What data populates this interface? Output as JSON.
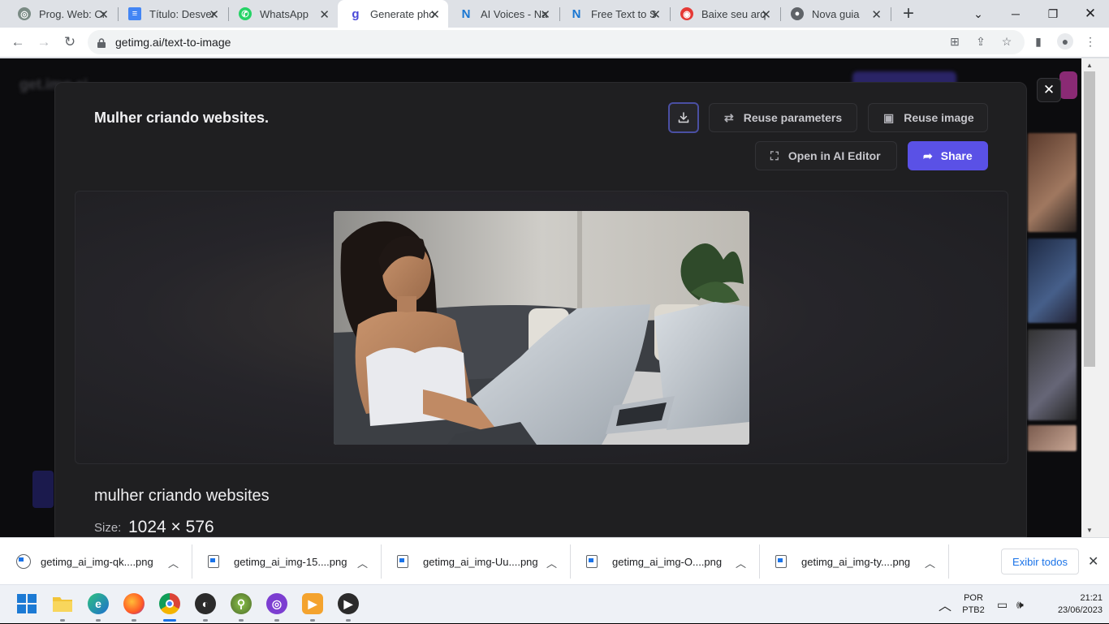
{
  "browser": {
    "tabs": [
      {
        "title": "Prog. Web: Cr",
        "icon": "chatgpt-icon",
        "color": "#6b6b6b"
      },
      {
        "title": "Título: Desver",
        "icon": "google-docs-icon",
        "color": "#4285f4"
      },
      {
        "title": "WhatsApp",
        "icon": "whatsapp-icon",
        "color": "#25d366"
      },
      {
        "title": "Generate pho",
        "icon": "getimg-icon",
        "color": "#4a49d8",
        "active": true
      },
      {
        "title": "AI Voices - Na",
        "icon": "naturalreaders-icon",
        "color": "#1976d2"
      },
      {
        "title": "Free Text to S",
        "icon": "naturalreaders-icon",
        "color": "#1976d2"
      },
      {
        "title": "Baixe seu arq",
        "icon": "pdf-icon",
        "color": "#e53935"
      },
      {
        "title": "Nova guia",
        "icon": "chrome-icon",
        "color": "#5f6368"
      }
    ],
    "url": "getimg.ai/text-to-image"
  },
  "modal": {
    "title": "Mulher criando websites.",
    "buttons": {
      "reuse_parameters": "Reuse parameters",
      "reuse_image": "Reuse image",
      "open_editor": "Open in AI Editor",
      "share": "Share"
    },
    "prompt": "mulher criando websites",
    "size_label": "Size:",
    "size_value": "1024 × 576"
  },
  "downloads": {
    "items": [
      "getimg_ai_img-qk....png",
      "getimg_ai_img-15....png",
      "getimg_ai_img-Uu....png",
      "getimg_ai_img-O....png",
      "getimg_ai_img-ty....png"
    ],
    "show_all": "Exibir todos"
  },
  "taskbar": {
    "apps": [
      "windows-start-icon",
      "file-explorer-icon",
      "edge-icon",
      "firefox-icon",
      "chrome-icon",
      "obs-icon",
      "tor-icon",
      "app-icon",
      "media-icon",
      "player-icon"
    ],
    "lang_top": "POR",
    "lang_bottom": "PTB2",
    "time": "21:21",
    "date": "23/06/2023"
  },
  "colors": {
    "accent": "#5a51e6",
    "modal_bg": "#1f1f21"
  }
}
